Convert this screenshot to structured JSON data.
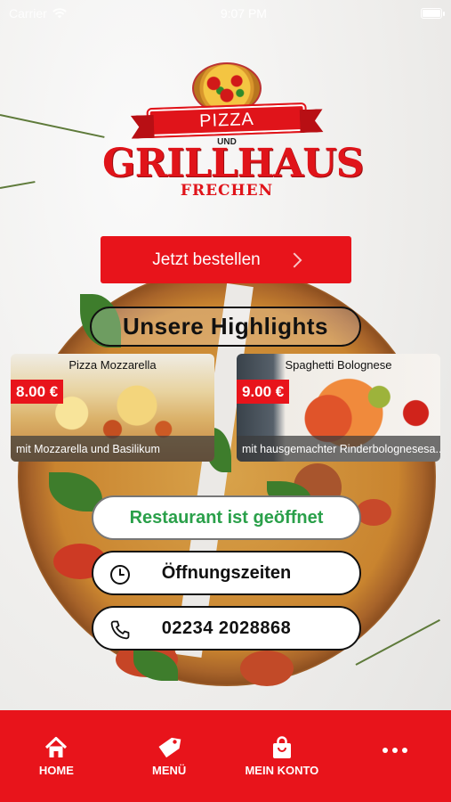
{
  "status_bar": {
    "carrier": "Carrier",
    "time": "9:07 PM"
  },
  "logo": {
    "ribbon": "PIZZA",
    "connector": "UND",
    "name": "GRILLHAUS",
    "city": "FRECHEN"
  },
  "order_button": {
    "label": "Jetzt bestellen"
  },
  "highlights": {
    "title": "Unsere Highlights",
    "items": [
      {
        "name": "Pizza Mozzarella",
        "price": "8.00 €",
        "description": "mit Mozzarella und Basilikum"
      },
      {
        "name": "Spaghetti Bolognese",
        "price": "9.00 €",
        "description": "mit hausgemachter Rinderbolognesesa..."
      }
    ]
  },
  "info": {
    "status": "Restaurant ist geöffnet",
    "hours": "Öffnungszeiten",
    "phone": "02234 2028868"
  },
  "colors": {
    "brand_red": "#e8141b",
    "open_green": "#2aa04a"
  },
  "nav": {
    "items": [
      {
        "label": "HOME",
        "icon": "home-icon"
      },
      {
        "label": "MENÜ",
        "icon": "tag-icon"
      },
      {
        "label": "MEIN KONTO",
        "icon": "bag-icon"
      },
      {
        "label": "",
        "icon": "more-icon"
      }
    ]
  }
}
